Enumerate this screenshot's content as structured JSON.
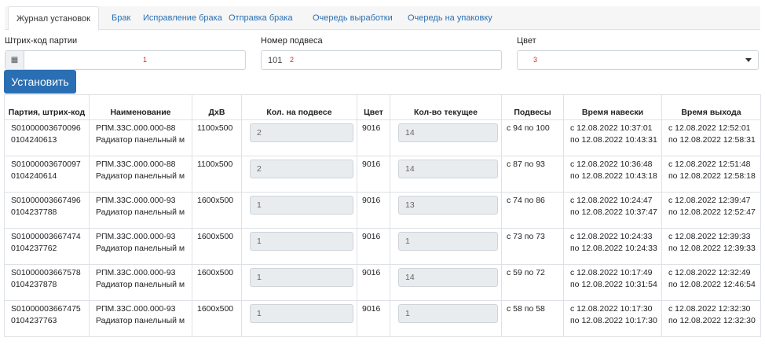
{
  "tabs": [
    {
      "label": "Журнал установок"
    },
    {
      "label": "Брак"
    },
    {
      "label": "Исправление брака"
    },
    {
      "label": "Отправка брака"
    },
    {
      "label": "Очередь выработки"
    },
    {
      "label": "Очередь на упаковку"
    }
  ],
  "form": {
    "barcode_label": "Штрих-код партии",
    "barcode_icon": "barcode-icon",
    "barcode_marker": "1",
    "hanger_label": "Номер подвеса",
    "hanger_value": "101",
    "hanger_marker": "2",
    "color_label": "Цвет",
    "color_marker": "3",
    "install_button": "Установить"
  },
  "table": {
    "headers": [
      "Партия, штрих-код",
      "Наименование",
      "ДхВ",
      "Кол. на подвесе",
      "Цвет",
      "Кол-во текущее",
      "Подвесы",
      "Время навески",
      "Время выхода"
    ],
    "rows": [
      {
        "batch": "S01000003670096 0104240613",
        "name": "РПМ.33С.000.000-88 Радиатор панельный м",
        "size": "1100x500",
        "qty": "2",
        "color": "9016",
        "current": "14",
        "hangers": "с 94 по 100",
        "hang_time": "с 12.08.2022 10:37:01 по 12.08.2022 10:43:31",
        "exit_time": "с 12.08.2022 12:52:01 по 12.08.2022 12:58:31"
      },
      {
        "batch": "S01000003670097 0104240614",
        "name": "РПМ.33С.000.000-88 Радиатор панельный м",
        "size": "1100x500",
        "qty": "2",
        "color": "9016",
        "current": "14",
        "hangers": "с 87 по 93",
        "hang_time": "с 12.08.2022 10:36:48 по 12.08.2022 10:43:18",
        "exit_time": "с 12.08.2022 12:51:48 по 12.08.2022 12:58:18"
      },
      {
        "batch": "S01000003667496 0104237788",
        "name": "РПМ.33С.000.000-93 Радиатор панельный м",
        "size": "1600x500",
        "qty": "1",
        "color": "9016",
        "current": "13",
        "hangers": "с 74 по 86",
        "hang_time": "с 12.08.2022 10:24:47 по 12.08.2022 10:37:47",
        "exit_time": "с 12.08.2022 12:39:47 по 12.08.2022 12:52:47"
      },
      {
        "batch": "S01000003667474 0104237762",
        "name": "РПМ.33С.000.000-93 Радиатор панельный м",
        "size": "1600x500",
        "qty": "1",
        "color": "9016",
        "current": "1",
        "hangers": "с 73 по 73",
        "hang_time": "с 12.08.2022 10:24:33 по 12.08.2022 10:24:33",
        "exit_time": "с 12.08.2022 12:39:33 по 12.08.2022 12:39:33"
      },
      {
        "batch": "S01000003667578 0104237878",
        "name": "РПМ.33С.000.000-93 Радиатор панельный м",
        "size": "1600x500",
        "qty": "1",
        "color": "9016",
        "current": "14",
        "hangers": "с 59 по 72",
        "hang_time": "с 12.08.2022 10:17:49 по 12.08.2022 10:31:54",
        "exit_time": "с 12.08.2022 12:32:49 по 12.08.2022 12:46:54"
      },
      {
        "batch": "S01000003667475 0104237763",
        "name": "РПМ.33С.000.000-93 Радиатор панельный м",
        "size": "1600x500",
        "qty": "1",
        "color": "9016",
        "current": "1",
        "hangers": "с 58 по 58",
        "hang_time": "с 12.08.2022 10:17:30 по 12.08.2022 10:17:30",
        "exit_time": "с 12.08.2022 12:32:30 по 12.08.2022 12:32:30"
      }
    ]
  }
}
